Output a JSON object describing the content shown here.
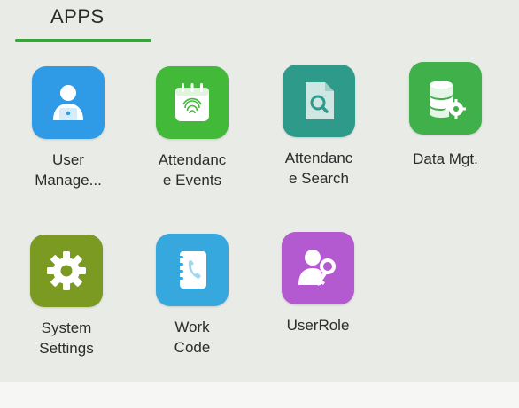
{
  "header": {
    "tab_label": "APPS"
  },
  "apps": [
    {
      "label": "User\nManage...",
      "icon": "user-management-icon",
      "color": "#2f9be6"
    },
    {
      "label": "Attendanc\ne Events",
      "icon": "attendance-events-icon",
      "color": "#43b93a"
    },
    {
      "label": "Attendanc\ne Search",
      "icon": "attendance-search-icon",
      "color": "#2e9a8a"
    },
    {
      "label": "Data Mgt.",
      "icon": "data-management-icon",
      "color": "#3fb04a"
    },
    {
      "label": "System\nSettings",
      "icon": "system-settings-icon",
      "color": "#7a9a22"
    },
    {
      "label": "Work\nCode",
      "icon": "work-code-icon",
      "color": "#36a8dd"
    },
    {
      "label": "UserRole",
      "icon": "user-role-icon",
      "color": "#b45ad0"
    }
  ],
  "colors": {
    "background": "#e9ebe7",
    "tab_underline": "#3aa33a"
  }
}
